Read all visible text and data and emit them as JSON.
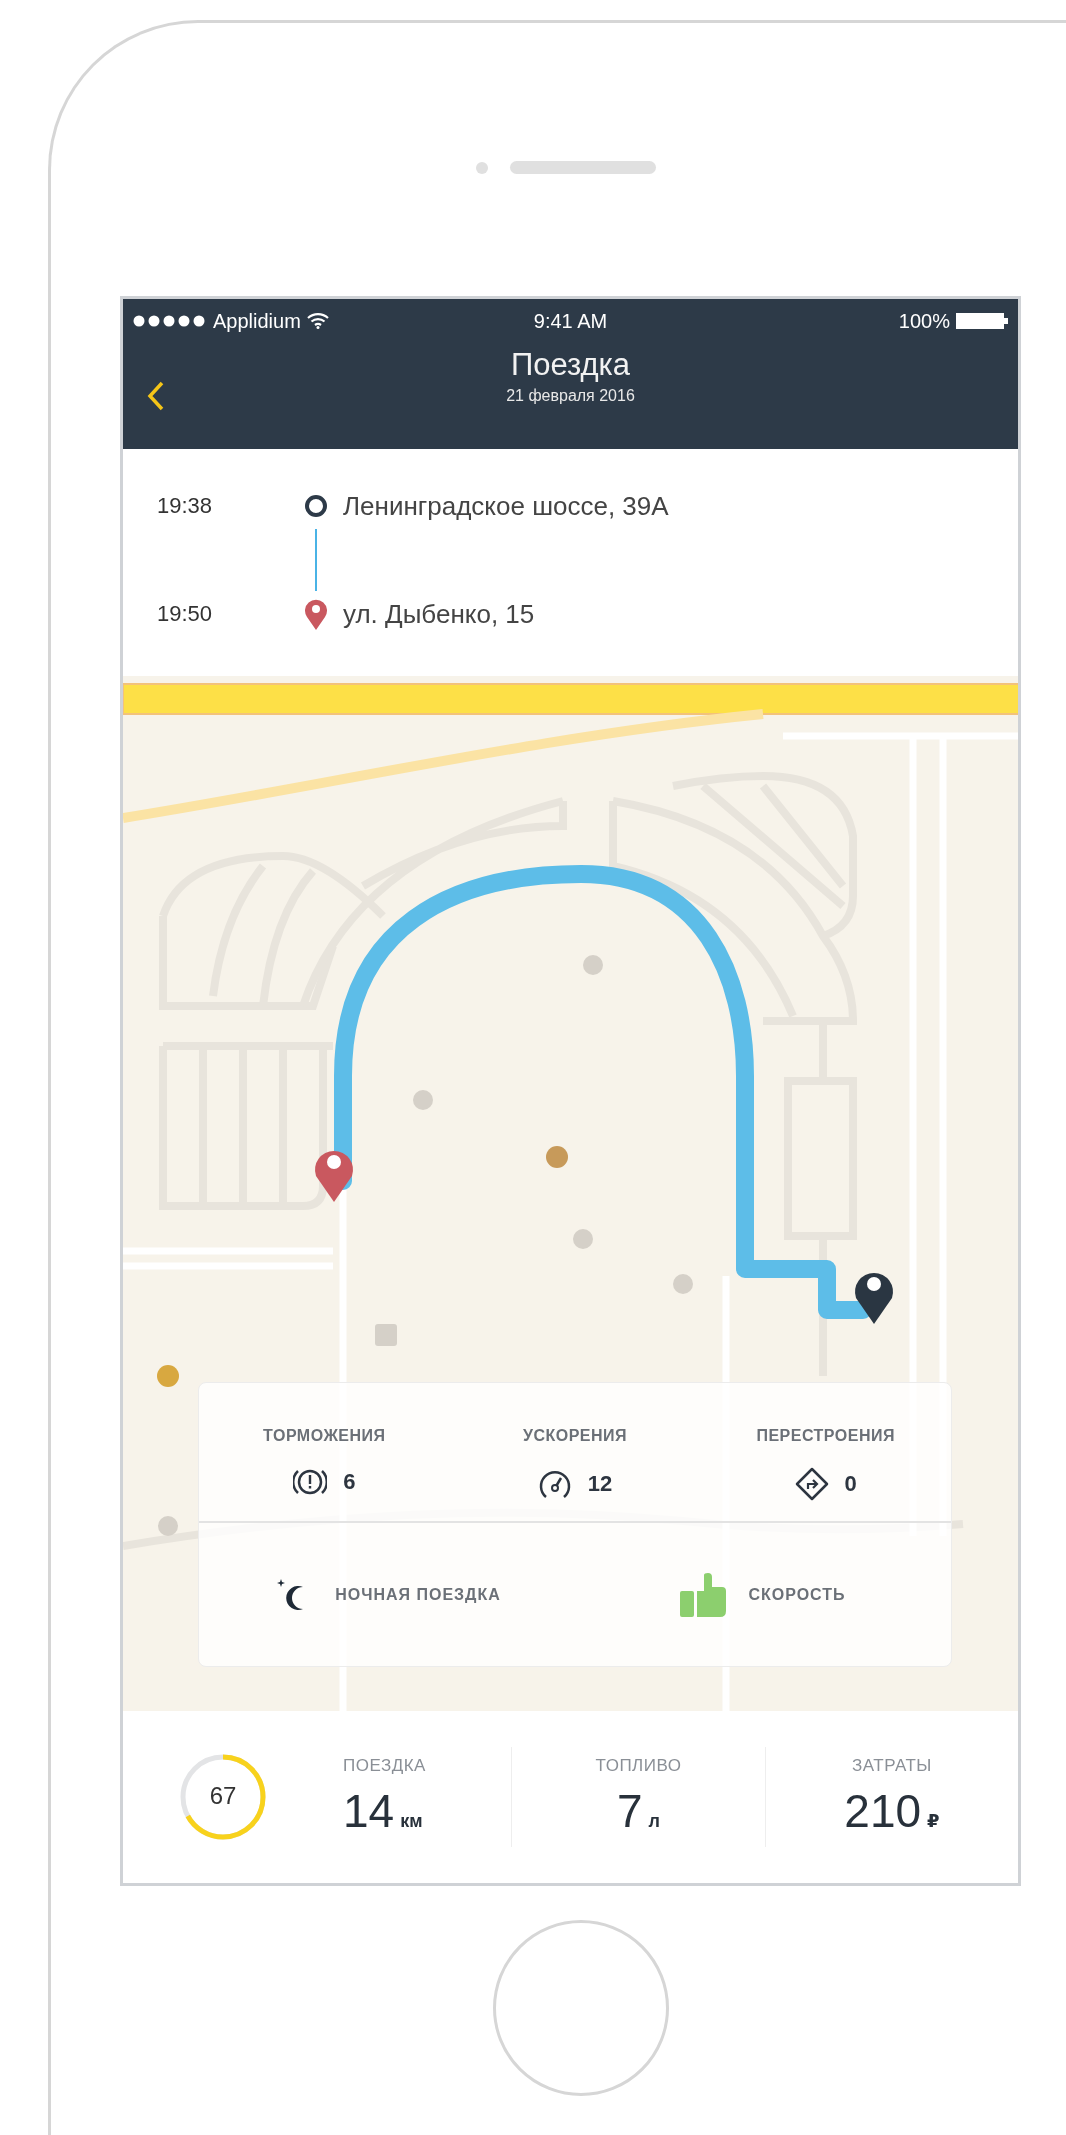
{
  "status_bar": {
    "carrier": "Applidium",
    "time": "9:41 AM",
    "battery": "100%"
  },
  "nav": {
    "title": "Поездка",
    "subtitle": "21 февраля 2016"
  },
  "stops": [
    {
      "kind": "start",
      "time": "19:38",
      "address": "Ленинградское шоссе, 39А"
    },
    {
      "kind": "end",
      "time": "19:50",
      "address": "ул. Дыбенко, 15"
    }
  ],
  "events": [
    {
      "kind": "braking",
      "label": "ТОРМОЖЕНИЯ",
      "count": "6"
    },
    {
      "kind": "acceleration",
      "label": "УСКОРЕНИЯ",
      "count": "12"
    },
    {
      "kind": "lane_change",
      "label": "ПЕРЕСТРОЕНИЯ",
      "count": "0"
    }
  ],
  "badges": [
    {
      "kind": "night",
      "label": "НОЧНАЯ ПОЕЗДКА"
    },
    {
      "kind": "speed",
      "label": "СКОРОСТЬ"
    }
  ],
  "summary": {
    "score": {
      "value": "67",
      "level": 0.67
    },
    "metrics": [
      {
        "label": "ПОЕЗДКА",
        "value": "14",
        "unit": "км"
      },
      {
        "label": "ТОПЛИВО",
        "value": "7",
        "unit": "л"
      },
      {
        "label": "ЗАТРАТЫ",
        "value": "210",
        "unit": "₽"
      }
    ]
  }
}
